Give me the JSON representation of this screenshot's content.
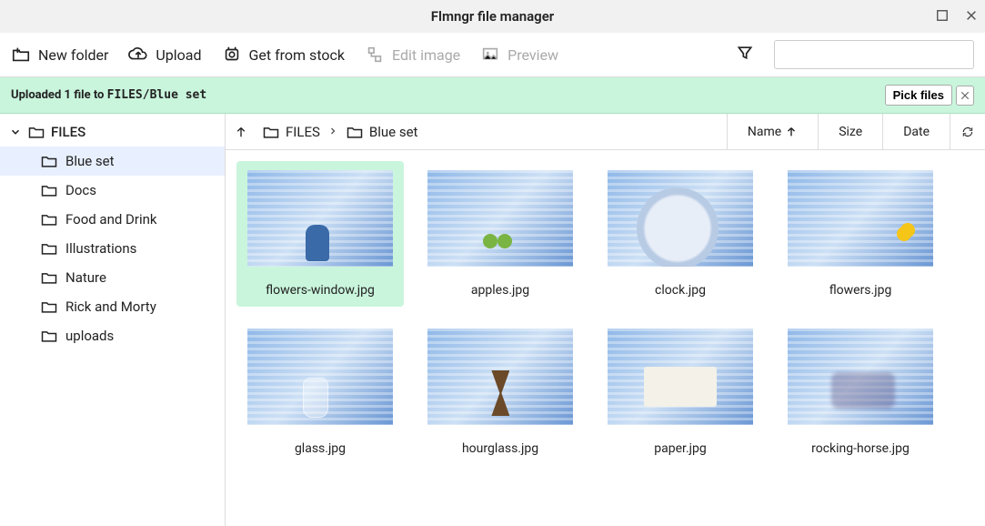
{
  "window": {
    "title": "Flmngr file manager"
  },
  "toolbar": {
    "new_folder": "New folder",
    "upload": "Upload",
    "get_stock": "Get from stock",
    "edit_image": "Edit image",
    "preview": "Preview",
    "search_placeholder": ""
  },
  "notif": {
    "prefix": "Uploaded 1 file to ",
    "path": "FILES/Blue set",
    "pick": "Pick files"
  },
  "sidebar": {
    "root": "FILES",
    "items": [
      {
        "label": "Blue set",
        "selected": true
      },
      {
        "label": "Docs"
      },
      {
        "label": "Food and Drink"
      },
      {
        "label": "Illustrations"
      },
      {
        "label": "Nature"
      },
      {
        "label": "Rick and Morty"
      },
      {
        "label": "uploads"
      }
    ]
  },
  "breadcrumb": {
    "root": "FILES",
    "current": "Blue set"
  },
  "sort": {
    "name": "Name",
    "size": "Size",
    "date": "Date"
  },
  "files": [
    {
      "name": "flowers-window.jpg",
      "selected": true,
      "accent": "acc-vase"
    },
    {
      "name": "apples.jpg",
      "accent": "acc-apples"
    },
    {
      "name": "clock.jpg",
      "accent": "acc-clock"
    },
    {
      "name": "flowers.jpg",
      "accent": "acc-flower"
    },
    {
      "name": "glass.jpg",
      "accent": "acc-glass"
    },
    {
      "name": "hourglass.jpg",
      "accent": "acc-hourglass"
    },
    {
      "name": "paper.jpg",
      "accent": "acc-paper"
    },
    {
      "name": "rocking-horse.jpg",
      "accent": "acc-rock"
    }
  ]
}
